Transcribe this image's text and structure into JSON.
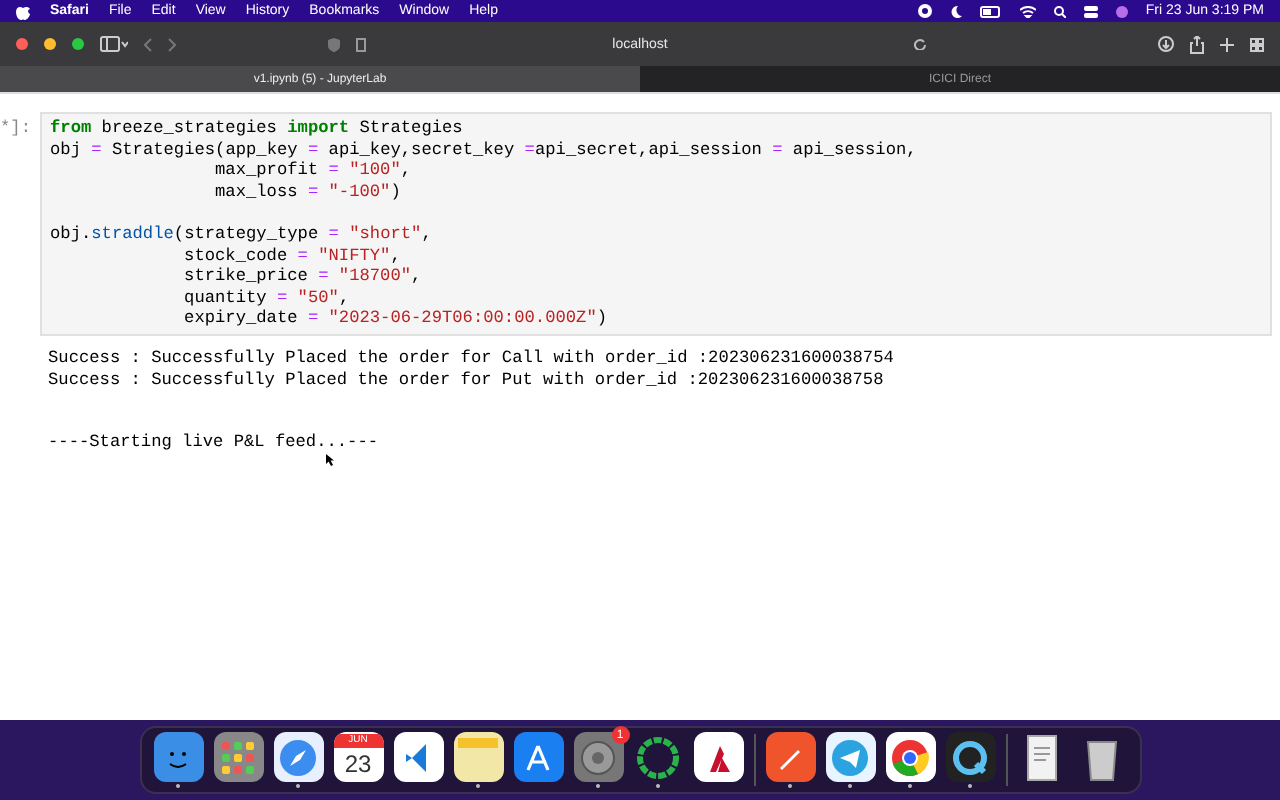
{
  "menu_bar": {
    "app": "Safari",
    "items": [
      "File",
      "Edit",
      "View",
      "History",
      "Bookmarks",
      "Window",
      "Help"
    ],
    "clock": "Fri 23 Jun  3:19 PM"
  },
  "toolbar": {
    "address": "localhost"
  },
  "tabs": [
    {
      "label": "v1.ipynb (5) - JupyterLab",
      "selected": true
    },
    {
      "label": "ICICI Direct",
      "selected": false
    }
  ],
  "cell": {
    "prompt": "*]:",
    "blocks": [
      [
        [
          {
            "kind": "kw",
            "text": "from"
          },
          {
            "kind": "plain",
            "text": " breeze_strategies "
          },
          {
            "kind": "kw",
            "text": "import"
          },
          {
            "kind": "plain",
            "text": " Strategies"
          }
        ],
        [
          {
            "kind": "plain",
            "text": "obj "
          },
          {
            "kind": "op",
            "text": "="
          },
          {
            "kind": "plain",
            "text": " Strategies(app_key "
          },
          {
            "kind": "op",
            "text": "="
          },
          {
            "kind": "plain",
            "text": " api_key,secret_key "
          },
          {
            "kind": "op",
            "text": "="
          },
          {
            "kind": "plain",
            "text": "api_secret,api_session "
          },
          {
            "kind": "op",
            "text": "="
          },
          {
            "kind": "plain",
            "text": " api_session,"
          }
        ],
        [
          {
            "kind": "plain",
            "text": "                max_profit "
          },
          {
            "kind": "op",
            "text": "="
          },
          {
            "kind": "str",
            "text": " \"100\""
          },
          {
            "kind": "plain",
            "text": ","
          }
        ],
        [
          {
            "kind": "plain",
            "text": "                max_loss "
          },
          {
            "kind": "op",
            "text": "="
          },
          {
            "kind": "str",
            "text": " \"-100\""
          },
          {
            "kind": "plain",
            "text": ")"
          }
        ]
      ],
      [
        [
          {
            "kind": "plain",
            "text": "obj."
          },
          {
            "kind": "fn",
            "text": "straddle"
          },
          {
            "kind": "plain",
            "text": "(strategy_type "
          },
          {
            "kind": "op",
            "text": "="
          },
          {
            "kind": "str",
            "text": " \"short\""
          },
          {
            "kind": "plain",
            "text": ","
          }
        ],
        [
          {
            "kind": "plain",
            "text": "             stock_code "
          },
          {
            "kind": "op",
            "text": "="
          },
          {
            "kind": "str",
            "text": " \"NIFTY\""
          },
          {
            "kind": "plain",
            "text": ","
          }
        ],
        [
          {
            "kind": "plain",
            "text": "             strike_price "
          },
          {
            "kind": "op",
            "text": "="
          },
          {
            "kind": "str",
            "text": " \"18700\""
          },
          {
            "kind": "plain",
            "text": ","
          }
        ],
        [
          {
            "kind": "plain",
            "text": "             quantity "
          },
          {
            "kind": "op",
            "text": "="
          },
          {
            "kind": "str",
            "text": " \"50\""
          },
          {
            "kind": "plain",
            "text": ","
          }
        ],
        [
          {
            "kind": "plain",
            "text": "             expiry_date "
          },
          {
            "kind": "op",
            "text": "="
          },
          {
            "kind": "str",
            "text": " \"2023-06-29T06:00:00.000Z\""
          },
          {
            "kind": "plain",
            "text": ")"
          }
        ]
      ]
    ]
  },
  "output": {
    "messages": [
      "Success : Successfully Placed the order for Call with order_id :202306231600038754",
      "Success : Successfully Placed the order for Put with order_id :202306231600038758"
    ],
    "feed": "----Starting live P&L feed...---"
  },
  "dock": [
    {
      "kind": "finder",
      "running": true
    },
    {
      "kind": "launchpad",
      "running": false
    },
    {
      "kind": "safari",
      "running": true
    },
    {
      "kind": "calendar",
      "running": false,
      "month": "JUN",
      "day": "23"
    },
    {
      "kind": "code",
      "running": false
    },
    {
      "kind": "notes",
      "running": true
    },
    {
      "kind": "store",
      "running": false
    },
    {
      "kind": "settings",
      "running": true,
      "badge": "1"
    },
    {
      "kind": "ring",
      "running": true
    },
    {
      "kind": "redapp",
      "running": false
    },
    {
      "kind": "divider"
    },
    {
      "kind": "pen",
      "running": true
    },
    {
      "kind": "telegram",
      "running": true
    },
    {
      "kind": "chrome",
      "running": true
    },
    {
      "kind": "quicktime",
      "running": true
    },
    {
      "kind": "divider"
    },
    {
      "kind": "document",
      "running": false
    },
    {
      "kind": "trash",
      "running": false
    }
  ]
}
